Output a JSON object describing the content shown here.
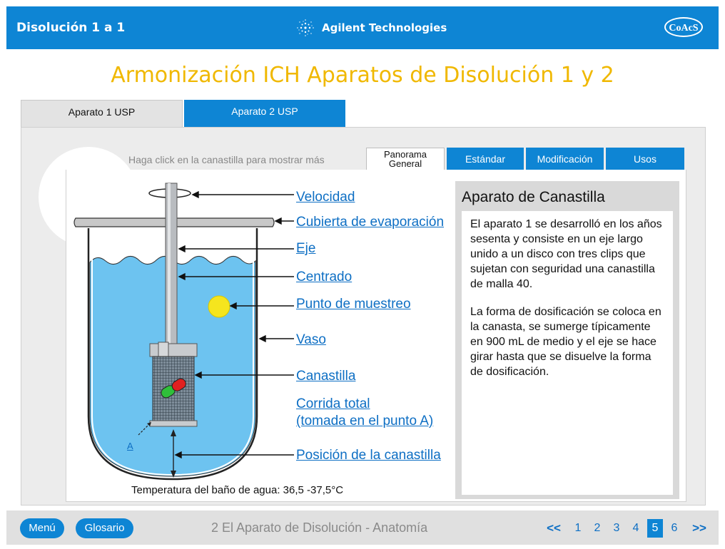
{
  "header": {
    "app_title": "Disolución 1 a 1",
    "brand": "Agilent Technologies",
    "coacs": "CoAcS"
  },
  "page_title": "Armonización ICH Aparatos de Disolución 1 y 2",
  "tabs": [
    {
      "label": "Aparato 1 USP",
      "active": true
    },
    {
      "label": "Aparato 2 USP",
      "active": false
    }
  ],
  "hint": "Haga click en la canastilla para mostrar más",
  "subtabs": [
    {
      "label": "Panorama General",
      "active": true
    },
    {
      "label": "Estándar",
      "active": false
    },
    {
      "label": "Modificación",
      "active": false
    },
    {
      "label": "Usos",
      "active": false
    }
  ],
  "diagram": {
    "labels": {
      "velocidad": "Velocidad",
      "cubierta": "Cubierta de evaporación",
      "eje": "Eje",
      "centrado": "Centrado",
      "punto_muestreo": "Punto de muestreo",
      "vaso": "Vaso",
      "canastilla": "Canastilla",
      "corrida_total_1": "Corrida total",
      "corrida_total_2": "(tomada en el punto A)",
      "posicion": "Posición de la canastilla",
      "point_a": "A"
    },
    "temperature": "Temperatura del baño de agua: 36,5 -37,5°C"
  },
  "panel": {
    "title": "Aparato de Canastilla",
    "paragraph_1": "El aparato 1 se desarrolló en los años sesenta y consiste en un eje largo unido a un disco con tres clips que sujetan con seguridad una canastilla de malla 40.",
    "paragraph_2": "La forma de dosificación se coloca en la canasta, se sumerge típicamente en 900 mL de medio y el eje se hace girar hasta que se disuelve la forma de dosificación."
  },
  "footer": {
    "menu": "Menú",
    "glosario": "Glosario",
    "section": "2 El Aparato de Disolución - Anatomía",
    "prev": "<<",
    "next": ">>",
    "pages": [
      "1",
      "2",
      "3",
      "4",
      "5",
      "6"
    ],
    "current_page": "5"
  },
  "colors": {
    "brand_blue": "#0e85d4",
    "title_gold": "#f0b800",
    "water": "#6dc3f0",
    "link": "#0e6fc4"
  }
}
